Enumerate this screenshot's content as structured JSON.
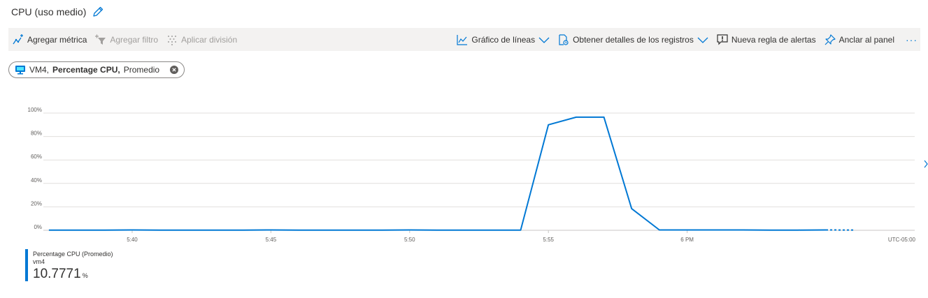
{
  "header": {
    "title": "CPU (uso medio)",
    "edit_icon": "pencil-icon"
  },
  "toolbar": {
    "add_metric": "Agregar métrica",
    "add_filter": "Agregar filtro",
    "apply_split": "Aplicar división",
    "line_chart": "Gráfico de líneas",
    "get_logs": "Obtener detalles de los registros",
    "new_alert": "Nueva regla de alertas",
    "pin": "Anclar al panel",
    "more": "···"
  },
  "pill": {
    "resource": "VM4,",
    "metric": "Percentage CPU,",
    "aggregation": "Promedio"
  },
  "legend": {
    "name": "Percentage CPU (Promedio)",
    "resource": "vm4",
    "value": "10.7771",
    "unit": "%"
  },
  "colors": {
    "accent": "#0078d4",
    "toolbar_bg": "#f3f2f1",
    "grid": "#e1dfdd"
  },
  "chart_data": {
    "type": "line",
    "yaxis_labels": [
      "100%",
      "80%",
      "60%",
      "40%",
      "20%",
      "0%"
    ],
    "xaxis_labels": [
      "5:40",
      "5:45",
      "5:50",
      "5:55",
      "6 PM"
    ],
    "timezone": "UTC-05:00",
    "ylim": [
      0,
      100
    ],
    "series": [
      {
        "name": "Percentage CPU (Promedio)",
        "x": [
          "5:37",
          "5:38",
          "5:39",
          "5:40",
          "5:41",
          "5:42",
          "5:43",
          "5:44",
          "5:45",
          "5:46",
          "5:47",
          "5:48",
          "5:49",
          "5:50",
          "5:51",
          "5:52",
          "5:53",
          "5:54",
          "5:55",
          "5:56",
          "5:57",
          "5:58",
          "5:59",
          "6:00",
          "6:01",
          "6:02",
          "6:03",
          "6:04",
          "6:05",
          "6:06"
        ],
        "values": [
          0.2,
          0.2,
          0.2,
          0.3,
          0.2,
          0.2,
          0.2,
          0.2,
          0.3,
          0.2,
          0.2,
          0.2,
          0.2,
          0.3,
          0.2,
          0.2,
          0.2,
          0.2,
          90,
          96.5,
          96.5,
          18.5,
          0.3,
          0.3,
          0.3,
          0.3,
          0.2,
          0.2,
          0.3,
          0.2
        ],
        "dashed_last_segment": true
      }
    ]
  }
}
